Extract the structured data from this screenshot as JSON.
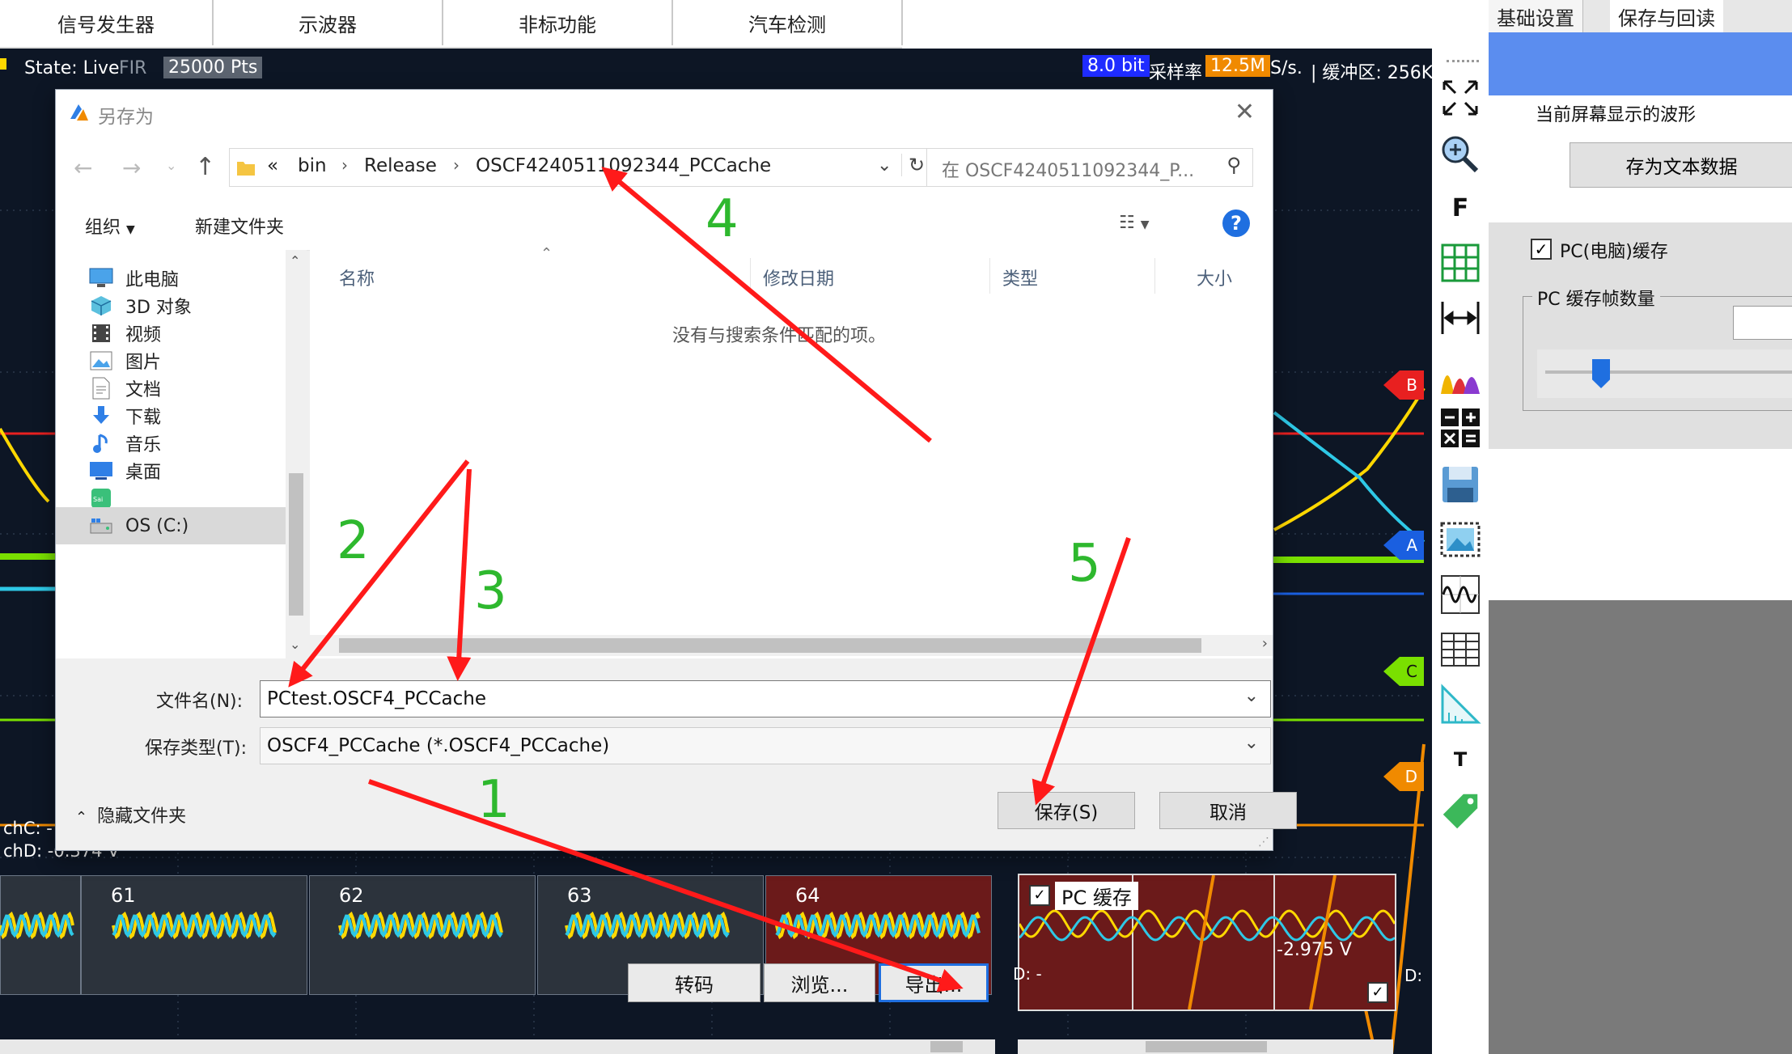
{
  "app": {
    "top_tabs": [
      "信号发生器",
      "示波器",
      "非标功能",
      "汽车检测"
    ],
    "status": {
      "state": "State: Live",
      "fir": "FIR",
      "points": "25000 Pts",
      "bits": "8.0 bit",
      "sample_rate_label": "采样率",
      "sample_rate_value": "12.5M",
      "sample_rate_unit": "S/s.",
      "buffer": "| 缓冲区: 256K."
    },
    "channel_markers": [
      "B",
      "A",
      "C",
      "D"
    ],
    "channel_readouts": {
      "chc": "chC: -",
      "chd": "chD: -0.374 V"
    },
    "toolbar_icons": [
      "fit-screen-icon",
      "zoom-in-icon",
      "f-icon",
      "grid-icon",
      "horizontal-measure-icon",
      "histogram-icon",
      "math-icon",
      "save-disk-icon",
      "image-icon",
      "waveform-icon",
      "table-icon",
      "ruler-icon",
      "text-icon",
      "tag-icon"
    ],
    "toolbar_f": "F",
    "toolbar_t": "T",
    "colors": {
      "scope_bg": "#0d1625",
      "yellow_trace": "#ffd800",
      "cyan_trace": "#2ec8e6",
      "red_line": "#e82020",
      "green_line": "#7ae000",
      "blue_line": "#1a5fe0",
      "orange_trace": "#f08a00",
      "accent_blue": "#5b8def",
      "thumb_red": "#6b1a1a"
    }
  },
  "right_panel": {
    "tabs": [
      "基础设置",
      "保存与回读"
    ],
    "group_label": "当前屏幕显示的波形",
    "save_text_button": "存为文本数据",
    "pc_cache_checkbox": "PC(电脑)缓存",
    "pc_cache_checked": true,
    "frame_count_label": "PC 缓存帧数量",
    "frame_slider_level": 0.2
  },
  "dialog": {
    "title": "另存为",
    "path": [
      "«",
      "bin",
      "Release",
      "OSCF4240511092344_PCCache"
    ],
    "search_placeholder": "在 OSCF4240511092344_P...",
    "commands": {
      "organize": "组织",
      "new_folder": "新建文件夹"
    },
    "nav_items": [
      {
        "label": "此电脑",
        "icon": "computer-icon"
      },
      {
        "label": "3D 对象",
        "icon": "cube-icon"
      },
      {
        "label": "视频",
        "icon": "video-icon"
      },
      {
        "label": "图片",
        "icon": "picture-icon"
      },
      {
        "label": "文档",
        "icon": "document-icon"
      },
      {
        "label": "下载",
        "icon": "download-icon"
      },
      {
        "label": "音乐",
        "icon": "music-icon"
      },
      {
        "label": "桌面",
        "icon": "desktop-icon"
      },
      {
        "label": "",
        "icon": "app-icon"
      },
      {
        "label": "OS (C:)",
        "icon": "drive-icon"
      }
    ],
    "columns": [
      "名称",
      "修改日期",
      "类型",
      "大小"
    ],
    "empty_message": "没有与搜索条件匹配的项。",
    "filename_label": "文件名(N):",
    "filename_value": "PCtest.OSCF4_PCCache",
    "filetype_label": "保存类型(T):",
    "filetype_value": "OSCF4_PCCache (*.OSCF4_PCCache)",
    "hide_folders": "隐藏文件夹",
    "save_button": "保存(S)",
    "cancel_button": "取消"
  },
  "thumbnails": {
    "numbers": [
      "61",
      "62",
      "63",
      "64"
    ],
    "buttons": [
      "转码",
      "浏览...",
      "导出..."
    ],
    "pc_cache_label": "PC 缓存",
    "pc_cache_checked": true,
    "readout": "-2.975 V",
    "left_readout": "D: -",
    "right_readout": "D:"
  },
  "annotations": [
    "1",
    "2",
    "3",
    "4",
    "5"
  ]
}
